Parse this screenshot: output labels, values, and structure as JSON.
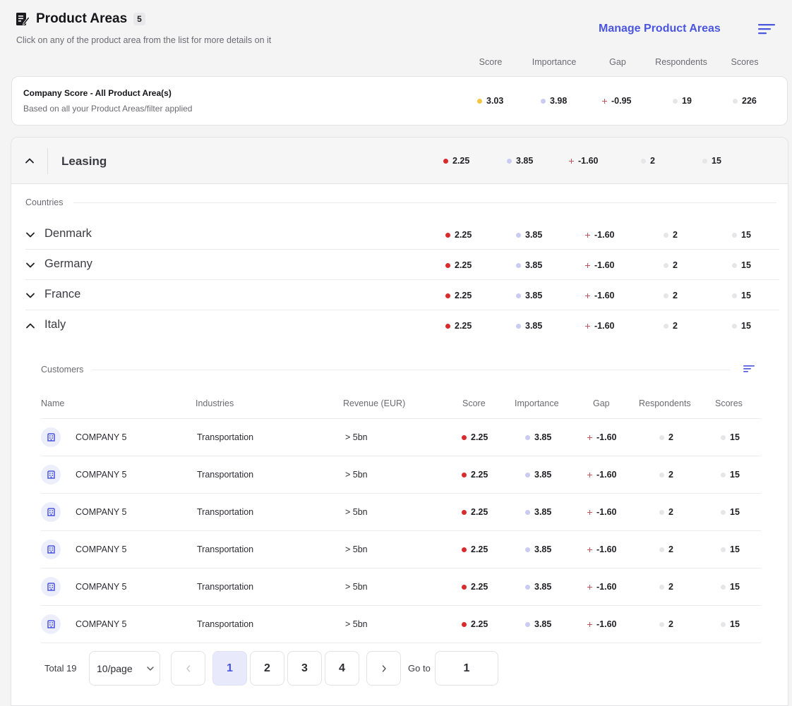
{
  "header": {
    "title": "Product Areas",
    "count": "5",
    "subtitle": "Click on any of the product area from the list for more details on it",
    "manage_label": "Manage Product Areas"
  },
  "columns": {
    "score": "Score",
    "importance": "Importance",
    "gap": "Gap",
    "respondents": "Respondents",
    "scores": "Scores"
  },
  "company_score": {
    "title": "Company Score - All Product Area(s)",
    "subtitle": "Based on all your Product Areas/filter applied",
    "score": "3.03",
    "importance": "3.98",
    "gap": "-0.95",
    "respondents": "19",
    "scores": "226",
    "score_color": "#f5c542"
  },
  "leasing": {
    "title": "Leasing",
    "score": "2.25",
    "importance": "3.85",
    "gap": "-1.60",
    "respondents": "2",
    "scores": "15",
    "score_color": "#d92b2b"
  },
  "countries_label": "Countries",
  "countries": [
    {
      "name": "Denmark",
      "expanded": false,
      "score": "2.25",
      "importance": "3.85",
      "gap": "-1.60",
      "respondents": "2",
      "scores": "15"
    },
    {
      "name": "Germany",
      "expanded": false,
      "score": "2.25",
      "importance": "3.85",
      "gap": "-1.60",
      "respondents": "2",
      "scores": "15"
    },
    {
      "name": "France",
      "expanded": false,
      "score": "2.25",
      "importance": "3.85",
      "gap": "-1.60",
      "respondents": "2",
      "scores": "15"
    },
    {
      "name": "Italy",
      "expanded": true,
      "score": "2.25",
      "importance": "3.85",
      "gap": "-1.60",
      "respondents": "2",
      "scores": "15"
    }
  ],
  "customers": {
    "label": "Customers",
    "headers": {
      "name": "Name",
      "industries": "Industries",
      "revenue": "Revenue (EUR)",
      "score": "Score",
      "importance": "Importance",
      "gap": "Gap",
      "respondents": "Respondents",
      "scores": "Scores"
    },
    "rows": [
      {
        "name": "COMPANY 5",
        "industry": "Transportation",
        "revenue": "> 5bn",
        "score": "2.25",
        "importance": "3.85",
        "gap": "-1.60",
        "respondents": "2",
        "scores": "15"
      },
      {
        "name": "COMPANY 5",
        "industry": "Transportation",
        "revenue": "> 5bn",
        "score": "2.25",
        "importance": "3.85",
        "gap": "-1.60",
        "respondents": "2",
        "scores": "15"
      },
      {
        "name": "COMPANY 5",
        "industry": "Transportation",
        "revenue": "> 5bn",
        "score": "2.25",
        "importance": "3.85",
        "gap": "-1.60",
        "respondents": "2",
        "scores": "15"
      },
      {
        "name": "COMPANY 5",
        "industry": "Transportation",
        "revenue": "> 5bn",
        "score": "2.25",
        "importance": "3.85",
        "gap": "-1.60",
        "respondents": "2",
        "scores": "15"
      },
      {
        "name": "COMPANY 5",
        "industry": "Transportation",
        "revenue": "> 5bn",
        "score": "2.25",
        "importance": "3.85",
        "gap": "-1.60",
        "respondents": "2",
        "scores": "15"
      },
      {
        "name": "COMPANY 5",
        "industry": "Transportation",
        "revenue": "> 5bn",
        "score": "2.25",
        "importance": "3.85",
        "gap": "-1.60",
        "respondents": "2",
        "scores": "15"
      }
    ]
  },
  "pagination": {
    "total": "Total 19",
    "page_size": "10/page",
    "pages": [
      "1",
      "2",
      "3",
      "4"
    ],
    "current_page": "1",
    "goto_label": "Go to",
    "goto_value": "1"
  },
  "colors": {
    "accent": "#4a55e0",
    "low_score": "#d92b2b",
    "mid_score": "#f5c542",
    "importance": "#c9cbf2",
    "neutral": "#e6e6e9"
  }
}
